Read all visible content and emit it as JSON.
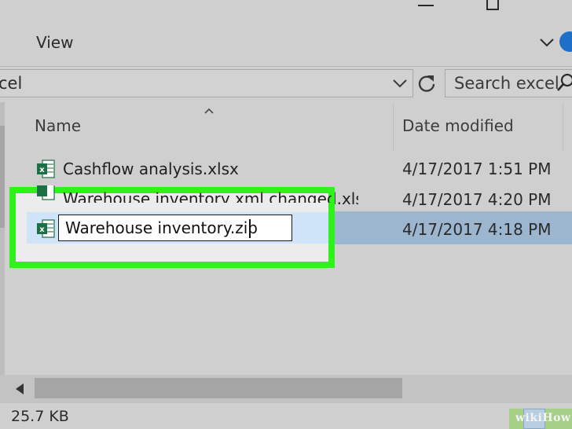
{
  "ribbon": {
    "view_tab": "View"
  },
  "address_bar": {
    "path": "cel"
  },
  "search": {
    "placeholder": "Search excel"
  },
  "columns": {
    "name": "Name",
    "date_modified": "Date modified"
  },
  "files": [
    {
      "name": "Cashflow analysis.xlsx",
      "date": "4/17/2017 1:51 PM"
    },
    {
      "name": "Warehouse inventory xml changed.xlsx",
      "date": "4/17/2017 4:20 PM"
    },
    {
      "name": "Warehouse inventory.zip",
      "date": "4/17/2017 4:18 PM",
      "selected": true,
      "renaming": true
    }
  ],
  "rename": {
    "value": "Warehouse inventory.zip"
  },
  "status": {
    "size": "25.7 KB"
  },
  "watermark": {
    "text": "wikiHow"
  },
  "colors": {
    "highlight": "#2ff21c",
    "selection": "#cfe4f8",
    "excel_green": "#1d7045",
    "help_blue": "#1e6fc8"
  },
  "icons": [
    "minimize-icon",
    "maximize-icon",
    "chevron-down-icon",
    "help-icon",
    "refresh-icon",
    "search-icon",
    "sort-up-icon",
    "excel-file-icon",
    "scroll-left-icon",
    "details-view-icon"
  ]
}
